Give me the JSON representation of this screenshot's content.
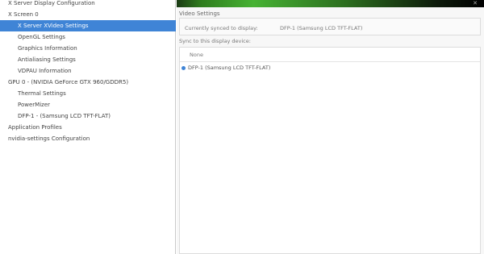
{
  "tree": {
    "items": [
      {
        "label": "X Server Display Configuration",
        "indent": 1,
        "selected": false
      },
      {
        "label": "X Screen 0",
        "indent": 1,
        "selected": false
      },
      {
        "label": "X Server XVideo Settings",
        "indent": 2,
        "selected": true
      },
      {
        "label": "OpenGL Settings",
        "indent": 2,
        "selected": false
      },
      {
        "label": "Graphics Information",
        "indent": 2,
        "selected": false
      },
      {
        "label": "Antialiasing Settings",
        "indent": 2,
        "selected": false
      },
      {
        "label": "VDPAU Information",
        "indent": 2,
        "selected": false
      },
      {
        "label": "GPU 0 - (NVIDIA GeForce GTX 960/GDDR5)",
        "indent": 1,
        "selected": false
      },
      {
        "label": "Thermal Settings",
        "indent": 2,
        "selected": false
      },
      {
        "label": "PowerMizer",
        "indent": 2,
        "selected": false
      },
      {
        "label": "DFP-1 - (Samsung LCD TFT-FLAT)",
        "indent": 2,
        "selected": false
      },
      {
        "label": "Application Profiles",
        "indent": 1,
        "selected": false
      },
      {
        "label": "nvidia-settings Configuration",
        "indent": 1,
        "selected": false
      }
    ]
  },
  "right": {
    "section_title": "Video Settings",
    "sync_label": "Currently synced to display:",
    "sync_value": "DFP-1 (Samsung LCD TFT-FLAT)",
    "list_title": "Sync to this display device:",
    "list_header": "None",
    "list_item": "DFP-1 (Samsung LCD TFT-FLAT)"
  },
  "colors": {
    "selection": "#3f84d6",
    "banner_accent": "#46b233"
  }
}
